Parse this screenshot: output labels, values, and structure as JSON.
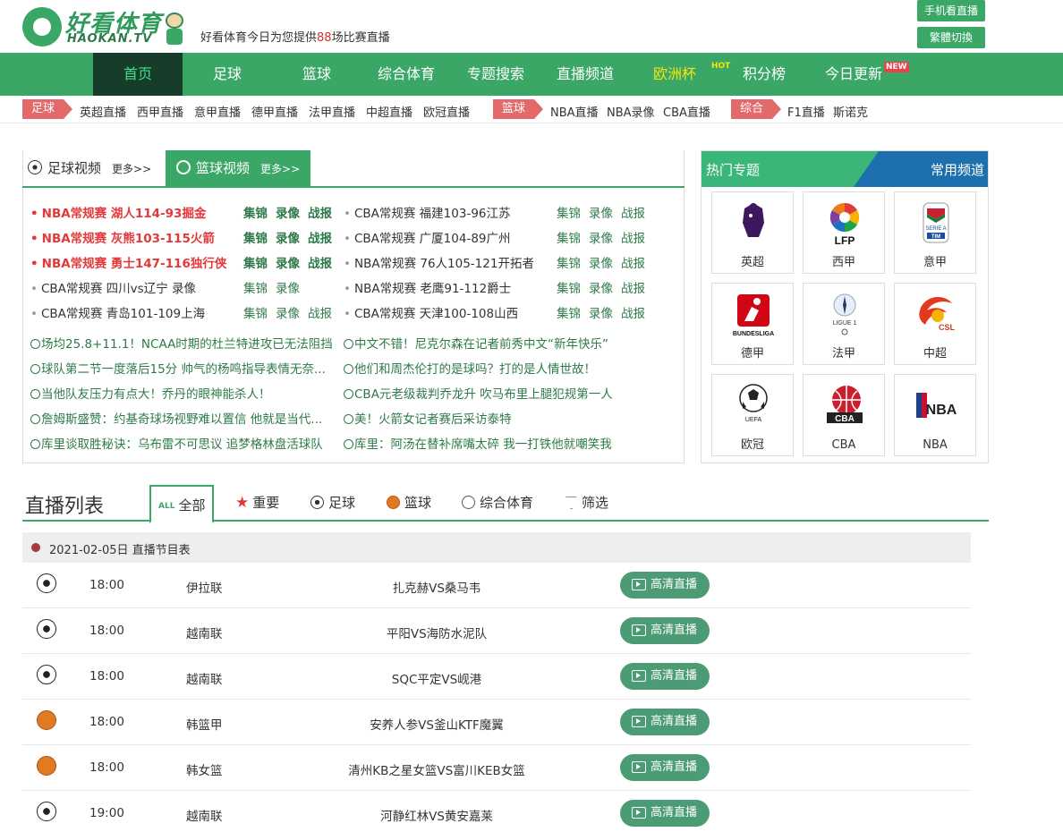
{
  "header": {
    "logo_cn": "好看体育",
    "logo_en": "HAOKAN.TV",
    "tagline_pre": "好看体育今日为您提供",
    "tagline_count": "88",
    "tagline_post": "场比赛直播",
    "btn_mobile": "手机看直播",
    "btn_trad": "繁體切換"
  },
  "nav": {
    "items": [
      "首页",
      "足球",
      "篮球",
      "综合体育",
      "专题搜索",
      "直播频道",
      "欧洲杯",
      "积分榜",
      "今日更新"
    ],
    "hot": "HOT",
    "new": "NEW"
  },
  "subnav": {
    "tag_football": "足球",
    "football_links": [
      "英超直播",
      "西甲直播",
      "意甲直播",
      "德甲直播",
      "法甲直播",
      "中超直播",
      "欧冠直播"
    ],
    "tag_basketball": "篮球",
    "basketball_links": [
      "NBA直播",
      "NBA录像",
      "CBA直播"
    ],
    "tag_general": "综合",
    "general_links": [
      "F1直播",
      "斯诺克"
    ]
  },
  "video": {
    "tab_football": "足球视频",
    "tab_basketball": "篮球视频",
    "more": "更多>>",
    "link_jijin": "集锦",
    "link_luxiang": "录像",
    "link_zhanbao": "战报",
    "left_games": [
      "NBA常规赛 湖人114-93掘金",
      "NBA常规赛 灰熊103-115火箭",
      "NBA常规赛 勇士147-116独行侠",
      "CBA常规赛 四川vs辽宁 录像",
      "CBA常规赛 青岛101-109上海"
    ],
    "right_games": [
      "CBA常规赛 福建103-96江苏",
      "CBA常规赛 广厦104-89广州",
      "NBA常规赛 76人105-121开拓者",
      "NBA常规赛 老鹰91-112爵士",
      "CBA常规赛 天津100-108山西"
    ],
    "left_news": [
      "场均25.8+11.1！NCAA时期的杜兰特进攻已无法阻挡",
      "球队第二节一度落后15分 帅气的杨鸣指导表情无奈...",
      "当他队友压力有点大！乔丹的眼神能杀人！",
      "詹姆斯盛赞：约基奇球场视野难以置信 他就是当代...",
      "库里谈取胜秘诀：乌布雷不可思议 追梦格林盘活球队"
    ],
    "right_news": [
      "中文不错！尼克尔森在记者前秀中文“新年快乐”",
      "他们和周杰伦打的是球吗？打的是人情世故！",
      "CBA元老级裁判乔龙升 吹马布里上腿犯规第一人",
      "美！火箭女记者赛后采访泰特",
      "库里：阿汤在替补席嘴太碎 我一打铁他就嘲笑我"
    ]
  },
  "hot": {
    "title": "热门专题",
    "channels": "常用频道",
    "leagues": [
      "英超",
      "西甲",
      "意甲",
      "德甲",
      "法甲",
      "中超",
      "欧冠",
      "CBA",
      "NBA"
    ],
    "logo_texts": [
      "LFP",
      "SERIE A",
      "TIM",
      "BUNDESLIGA",
      "LIGUE 1",
      "CSL",
      "UEFA",
      "CBA",
      "NBA"
    ]
  },
  "live": {
    "title": "直播列表",
    "tab_all_badge": "ALL",
    "tabs": [
      "全部",
      "重要",
      "足球",
      "篮球",
      "综合体育",
      "筛选"
    ],
    "date": "2021-02-05日 直播节目表",
    "watch_label": "高清直播",
    "matches": [
      {
        "time": "18:00",
        "league": "伊拉联",
        "teams": "扎克赫VS桑马韦",
        "sport": "soccer"
      },
      {
        "time": "18:00",
        "league": "越南联",
        "teams": "平阳VS海防水泥队",
        "sport": "soccer"
      },
      {
        "time": "18:00",
        "league": "越南联",
        "teams": "SQC平定VS岘港",
        "sport": "soccer"
      },
      {
        "time": "18:00",
        "league": "韩篮甲",
        "teams": "安养人参VS釜山KTF魔翼",
        "sport": "basketball"
      },
      {
        "time": "18:00",
        "league": "韩女篮",
        "teams": "清州KB之星女篮VS富川KEB女篮",
        "sport": "basketball"
      },
      {
        "time": "19:00",
        "league": "越南联",
        "teams": "河静红林VS黄安嘉莱",
        "sport": "soccer"
      }
    ]
  },
  "colors": {
    "brand_green": "#3aa767",
    "nav_active_bg": "#173c2a",
    "tag_red": "#e26a6a",
    "headline_red": "#e2393b",
    "channels_blue": "#1e6fae"
  }
}
